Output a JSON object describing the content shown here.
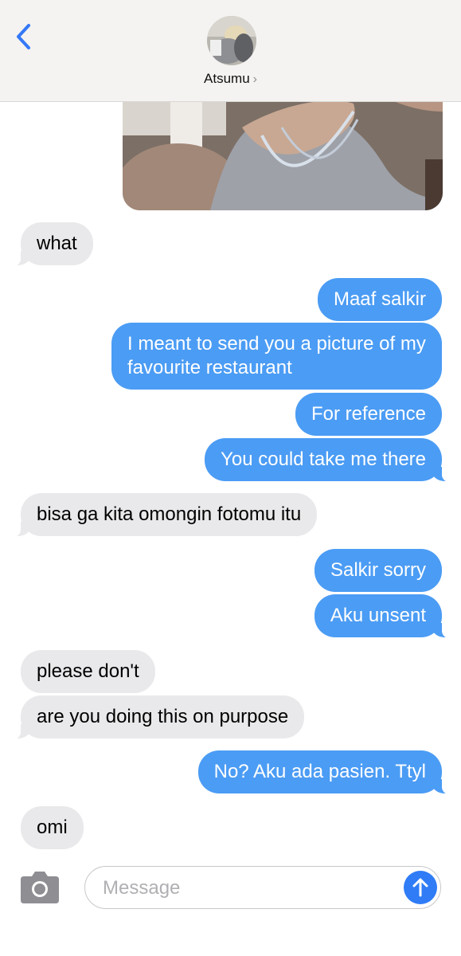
{
  "header": {
    "contact_name": "Atsumu",
    "chevron": "›",
    "back_icon": "chevron-left-icon",
    "accent": "#3478f6"
  },
  "messages": [
    {
      "dir": "in",
      "text": "what"
    },
    {
      "dir": "out",
      "text": "Maaf salkir"
    },
    {
      "dir": "out",
      "text": "I meant to send you a picture of my favourite restaurant"
    },
    {
      "dir": "out",
      "text": "For reference"
    },
    {
      "dir": "out",
      "text": "You could take me there"
    },
    {
      "dir": "in",
      "text": "bisa ga kita omongin fotomu itu"
    },
    {
      "dir": "out",
      "text": "Salkir sorry"
    },
    {
      "dir": "out",
      "text": "Aku unsent"
    },
    {
      "dir": "in",
      "text": "please don't"
    },
    {
      "dir": "in",
      "text": "are you doing this on purpose"
    },
    {
      "dir": "out",
      "text": "No? Aku ada pasien. Ttyl"
    },
    {
      "dir": "in",
      "text": "omi"
    }
  ],
  "composer": {
    "placeholder": "Message",
    "camera_icon": "camera-icon",
    "send_icon": "arrow-up-icon"
  },
  "colors": {
    "outgoing": "#4b9cf4",
    "incoming": "#e9e9eb",
    "send_button": "#2f7cf6"
  }
}
